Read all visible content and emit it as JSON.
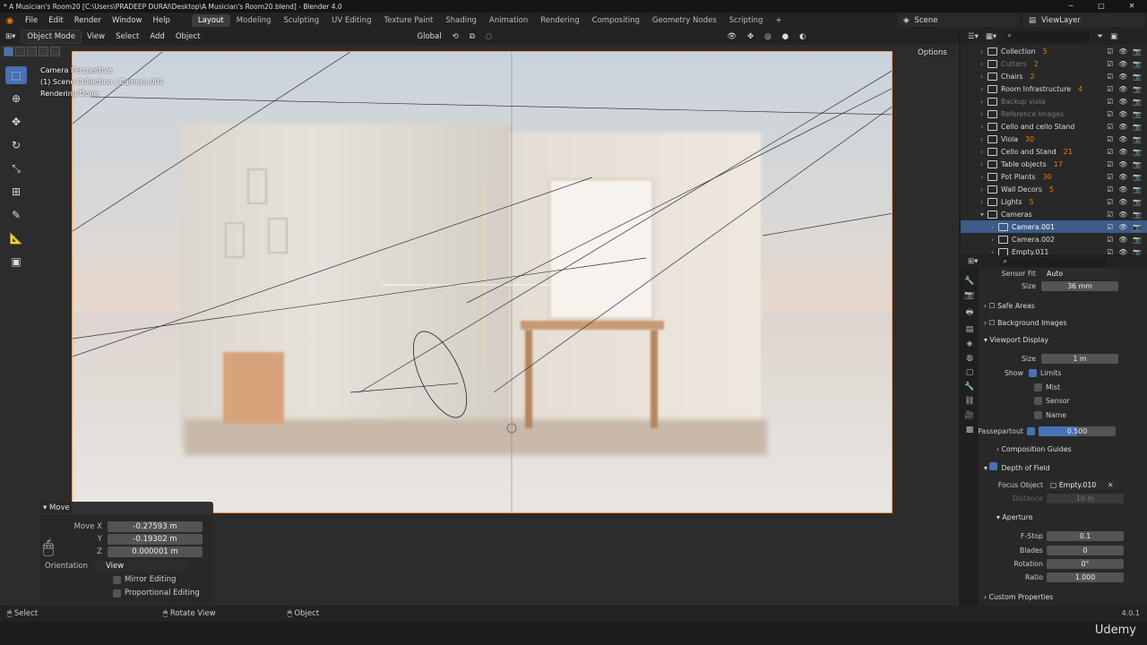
{
  "title_bar": {
    "text": "* A Musician's Room20 [C:\\Users\\PRADEEP DURAI\\Desktop\\A Musician's Room20.blend] - Blender 4.0",
    "min": "─",
    "max": "□",
    "close": "✕"
  },
  "menu": [
    "File",
    "Edit",
    "Render",
    "Window",
    "Help"
  ],
  "workspaces": [
    {
      "label": "Layout",
      "active": true
    },
    {
      "label": "Modeling"
    },
    {
      "label": "Sculpting"
    },
    {
      "label": "UV Editing"
    },
    {
      "label": "Texture Paint"
    },
    {
      "label": "Shading"
    },
    {
      "label": "Animation"
    },
    {
      "label": "Rendering"
    },
    {
      "label": "Compositing"
    },
    {
      "label": "Geometry Nodes"
    },
    {
      "label": "Scripting"
    }
  ],
  "workspace_add": "+",
  "scene": {
    "label": "Scene"
  },
  "view_layer": {
    "label": "ViewLayer"
  },
  "viewport_header": {
    "mode": "Object Mode",
    "menus": [
      "View",
      "Select",
      "Add",
      "Object"
    ],
    "transform": "Global",
    "options": "Options"
  },
  "viewport_overlay": {
    "line1": "Camera Perspective",
    "line2": "(1) Scene Collection | Camera.001",
    "line3": "Rendering Done"
  },
  "move_panel": {
    "title": "Move",
    "move_x_label": "Move X",
    "move_x": "-0.27593 m",
    "y_label": "Y",
    "y": "-0.19302 m",
    "z_label": "Z",
    "z": "0.000001 m",
    "orientation_label": "Orientation",
    "orientation": "View",
    "mirror": "Mirror Editing",
    "proportional": "Proportional Editing"
  },
  "status_bar": {
    "select": "Select",
    "rotate": "Rotate View",
    "object": "Object"
  },
  "version": "4.0.1",
  "watermark": "Udemy",
  "outliner": {
    "items": [
      {
        "label": "Collection",
        "count": "5"
      },
      {
        "label": "Cutters",
        "count": "2",
        "dim": true
      },
      {
        "label": "Chairs",
        "count": "2"
      },
      {
        "label": "Room Infrastructure",
        "count": "4"
      },
      {
        "label": "Backup viola",
        "dim": true
      },
      {
        "label": "Reference Images",
        "dim": true
      },
      {
        "label": "Cello and cello Stand"
      },
      {
        "label": "Viola",
        "count": "30"
      },
      {
        "label": "Cello and Stand",
        "count": "21"
      },
      {
        "label": "Table objects",
        "count": "17"
      },
      {
        "label": "Pot Plants",
        "count": "30"
      },
      {
        "label": "Wall Decors",
        "count": "5"
      },
      {
        "label": "Lights",
        "count": "5"
      },
      {
        "label": "Cameras"
      },
      {
        "label": "Camera.001",
        "selected": true
      },
      {
        "label": "Camera.002"
      },
      {
        "label": "Empty.011"
      }
    ]
  },
  "properties": {
    "sensor_fit_label": "Sensor Fit",
    "sensor_fit": "Auto",
    "size_label": "Size",
    "size": "36 mm",
    "safe_areas": "Safe Areas",
    "background_images": "Background Images",
    "viewport_display": "Viewport Display",
    "vd_size_label": "Size",
    "vd_size": "1 m",
    "show_label": "Show",
    "limits": "Limits",
    "mist": "Mist",
    "sensor": "Sensor",
    "name": "Name",
    "passepartout_label": "Passepartout",
    "passepartout": "0.500",
    "passepartout_value": 0.5,
    "composition_guides": "Composition Guides",
    "depth_of_field": "Depth of Field",
    "focus_object_label": "Focus Object",
    "focus_object": "Empty.010",
    "distance_label": "Distance",
    "distance": "10 m",
    "aperture": "Aperture",
    "fstop_label": "F-Stop",
    "fstop": "0.1",
    "blades_label": "Blades",
    "blades": "0",
    "rotation_label": "Rotation",
    "rotation": "0°",
    "ratio_label": "Ratio",
    "ratio": "1.000",
    "custom_properties": "Custom Properties"
  }
}
